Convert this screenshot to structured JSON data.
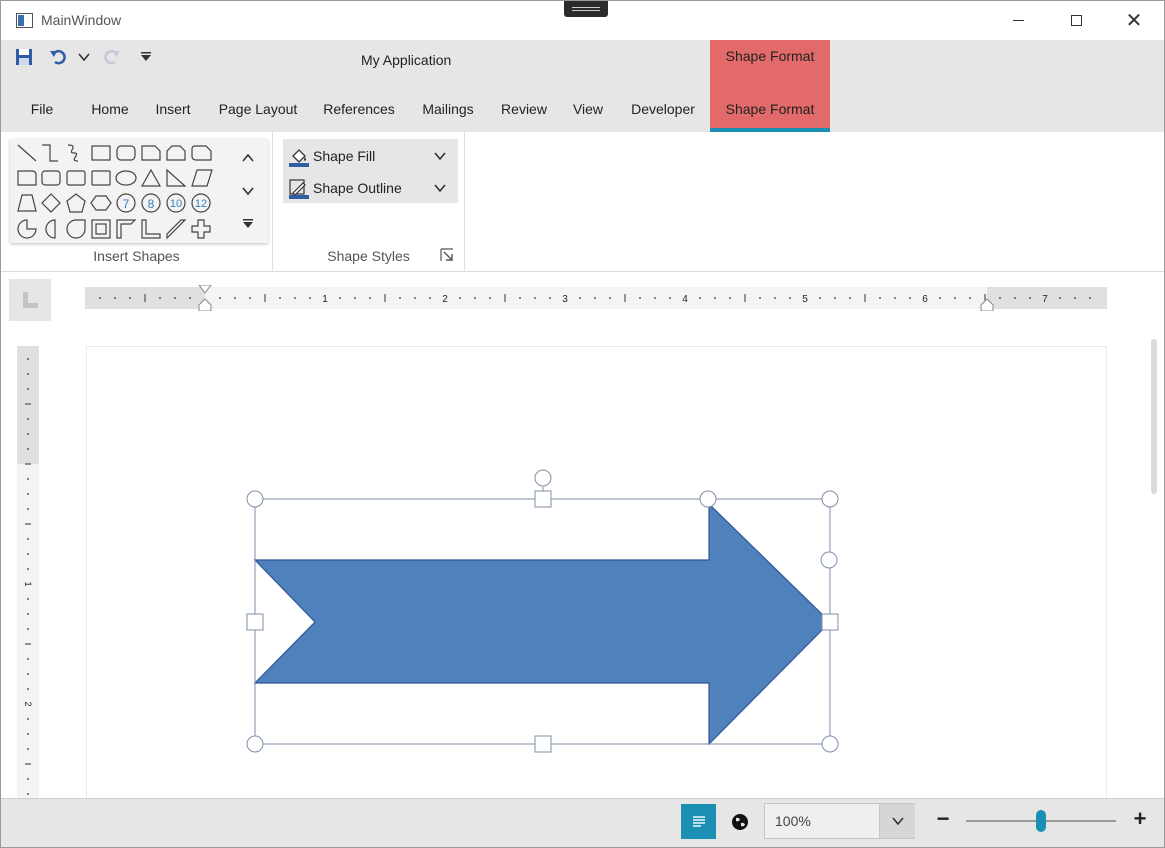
{
  "window": {
    "title": "MainWindow"
  },
  "ribbon": {
    "app_title": "My Application",
    "contextual_header": "Shape Format",
    "tabs": [
      {
        "label": "File"
      },
      {
        "label": "Home"
      },
      {
        "label": "Insert"
      },
      {
        "label": "Page Layout"
      },
      {
        "label": "References"
      },
      {
        "label": "Mailings"
      },
      {
        "label": "Review"
      },
      {
        "label": "View"
      },
      {
        "label": "Developer"
      },
      {
        "label": "Shape Format",
        "active": true
      }
    ],
    "groups": {
      "insert_shapes": {
        "label": "Insert Shapes",
        "gallery_numbers": [
          "7",
          "8",
          "10",
          "12"
        ]
      },
      "shape_styles": {
        "label": "Shape Styles",
        "shape_fill": "Shape Fill",
        "shape_outline": "Shape Outline"
      }
    }
  },
  "ruler": {
    "numbers": [
      "1",
      "2",
      "3",
      "4",
      "5",
      "6",
      "7"
    ],
    "vertical_numbers": [
      "1",
      "2"
    ]
  },
  "shape": {
    "type": "right-arrow",
    "fill": "#4f81bd",
    "outline": "#2f5597"
  },
  "status": {
    "zoom_value": "100%",
    "zoom_minus": "−",
    "zoom_plus": "+",
    "zoom_fraction": 0.5
  },
  "colors": {
    "accent": "#1b8fb4",
    "contextual": "#e26a6a"
  }
}
